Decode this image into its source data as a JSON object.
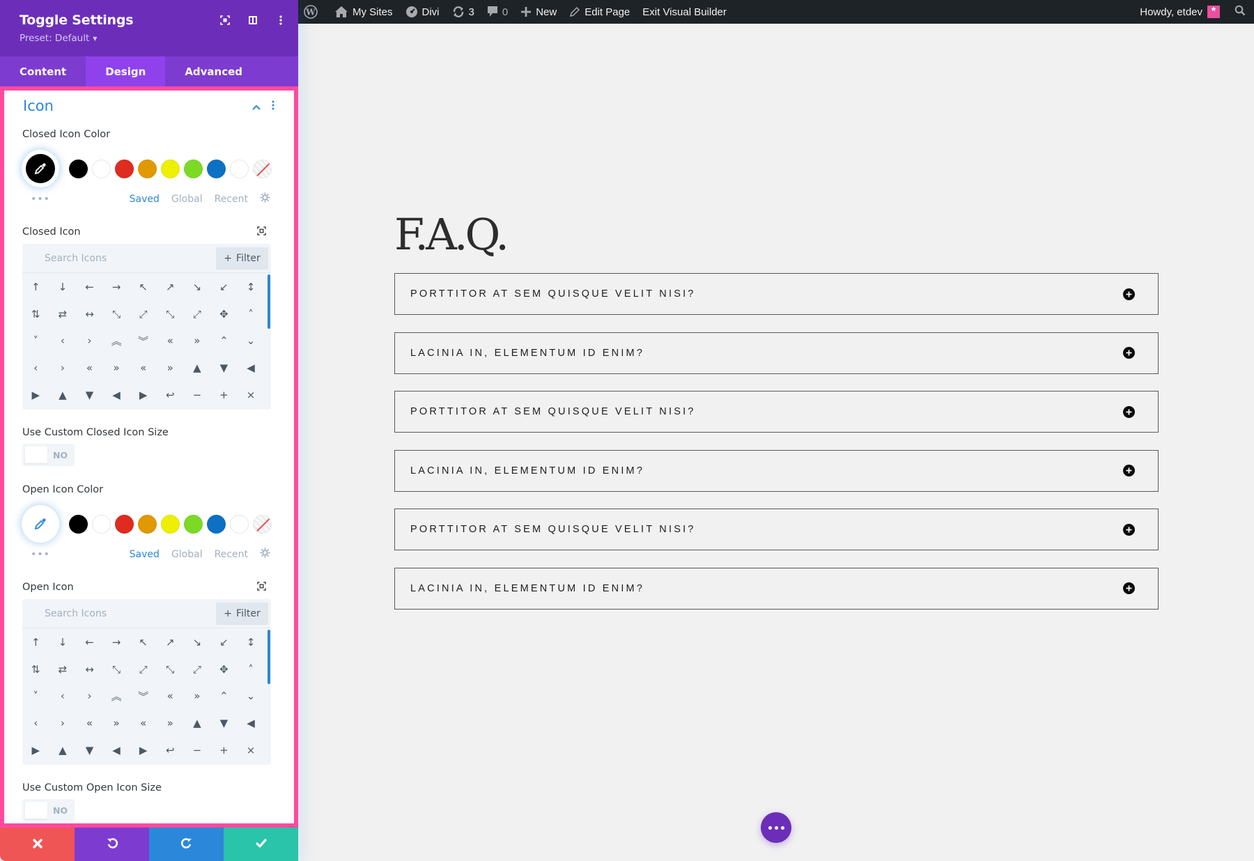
{
  "adminbar": {
    "items": [
      {
        "icon": "wordpress-logo-icon",
        "label": ""
      },
      {
        "icon": "my-sites-icon",
        "label": "My Sites"
      },
      {
        "icon": "divi-dashboard-icon",
        "label": "Divi"
      },
      {
        "icon": "updates-icon",
        "label": "3"
      },
      {
        "icon": "comments-icon",
        "label": "0"
      },
      {
        "icon": "plus-icon",
        "label": "New"
      },
      {
        "icon": "pencil-icon",
        "label": "Edit Page"
      },
      {
        "icon": "",
        "label": "Exit Visual Builder"
      }
    ],
    "greeting": "Howdy, etdev",
    "search_icon": "search-icon"
  },
  "panel": {
    "title": "Toggle Settings",
    "preset": "Preset: Default",
    "header_icons": [
      "expand-icon",
      "split-view-icon",
      "kebab-menu-icon"
    ],
    "tabs": [
      {
        "label": "Content",
        "active": false
      },
      {
        "label": "Design",
        "active": true
      },
      {
        "label": "Advanced",
        "active": false
      }
    ],
    "section": {
      "title": "Icon",
      "closed_icon_color": {
        "label": "Closed Icon Color",
        "current": "#000000",
        "swatches": [
          "#000000",
          "#ffffff",
          "#e02b20",
          "#e09900",
          "#edf000",
          "#7cda24",
          "#0c71c3",
          "#ffffff",
          "none"
        ],
        "tabs": [
          "Saved",
          "Global",
          "Recent"
        ],
        "active_tab": "Saved"
      },
      "closed_icon": {
        "label": "Closed Icon",
        "search_placeholder": "Search Icons",
        "filter_label": "Filter",
        "icons": [
          "↑",
          "↓",
          "←",
          "→",
          "↖",
          "↗",
          "↘",
          "↙",
          "↕",
          "⇅",
          "⇄",
          "↔",
          "⤡",
          "⤢",
          "⤡",
          "⤢",
          "✥",
          "˄",
          "˅",
          "‹",
          "›",
          "︽",
          "︾",
          "«",
          "»",
          "⌃",
          "⌄",
          "‹",
          "›",
          "«",
          "»",
          "«",
          "»",
          "▲",
          "▼",
          "◀",
          "▶",
          "▲",
          "▼",
          "◀",
          "▶",
          "↩",
          "−",
          "+",
          "×"
        ]
      },
      "closed_icon_size": {
        "label": "Use Custom Closed Icon Size",
        "value": "NO"
      },
      "open_icon_color": {
        "label": "Open Icon Color",
        "current": "",
        "swatches": [
          "#000000",
          "#ffffff",
          "#e02b20",
          "#e09900",
          "#edf000",
          "#7cda24",
          "#0c71c3",
          "#ffffff",
          "none"
        ],
        "tabs": [
          "Saved",
          "Global",
          "Recent"
        ],
        "active_tab": "Saved"
      },
      "open_icon": {
        "label": "Open Icon",
        "search_placeholder": "Search Icons",
        "filter_label": "Filter"
      },
      "open_icon_size": {
        "label": "Use Custom Open Icon Size",
        "value": "NO"
      }
    },
    "footer_buttons": [
      {
        "name": "discard",
        "color": "#ef5555"
      },
      {
        "name": "undo",
        "color": "#7e3bd0"
      },
      {
        "name": "redo",
        "color": "#2b87da"
      },
      {
        "name": "save",
        "color": "#29c4a9"
      }
    ]
  },
  "colors": {
    "accent_blue": "#2b87da",
    "purple": "#6c2eb9",
    "pink_frame": "#ff4a9e"
  },
  "page": {
    "title": "F.A.Q.",
    "toggles": [
      {
        "title": "Porttitor at sem quisque velit nisi?"
      },
      {
        "title": "Lacinia in, elementum id enim?"
      },
      {
        "title": "Porttitor at sem quisque velit nisi?"
      },
      {
        "title": "Lacinia in, elementum id enim?"
      },
      {
        "title": "Porttitor at sem quisque velit nisi?"
      },
      {
        "title": "Lacinia in, elementum id enim?"
      }
    ]
  }
}
